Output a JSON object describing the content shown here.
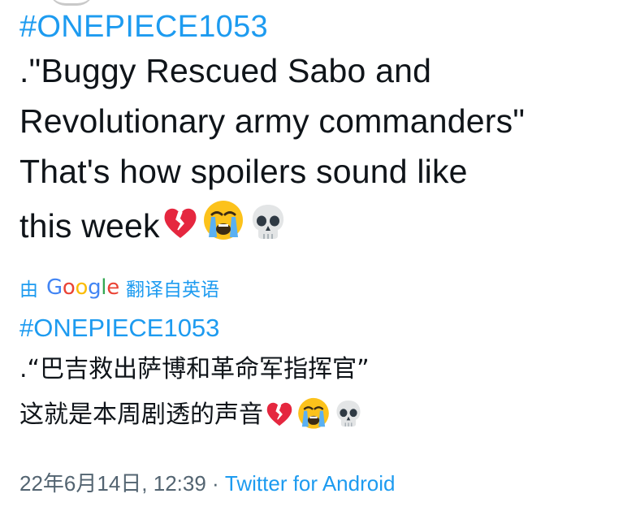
{
  "tweet": {
    "hashtag": "#ONEPIECE1053",
    "text_lines": [
      ".\"Buggy Rescued  Sabo and",
      "Revolutionary army commanders\"",
      "That's how spoilers sound like",
      "this week"
    ],
    "emojis": [
      "broken-heart-icon",
      "crying-face-icon",
      "skull-icon"
    ]
  },
  "translation": {
    "prefix": "由",
    "provider": "Google",
    "label": "翻译自英语",
    "hashtag": "#ONEPIECE1053",
    "text_lines": [
      ".“巴吉救出萨博和革命军指挥官”",
      "这就是本周剧透的声音"
    ]
  },
  "meta": {
    "timestamp": "22年6月14日, 12:39",
    "separator": " · ",
    "source": "Twitter for Android"
  },
  "colors": {
    "link": "#1d9bf0",
    "text": "#0f1419",
    "muted": "#536471"
  }
}
